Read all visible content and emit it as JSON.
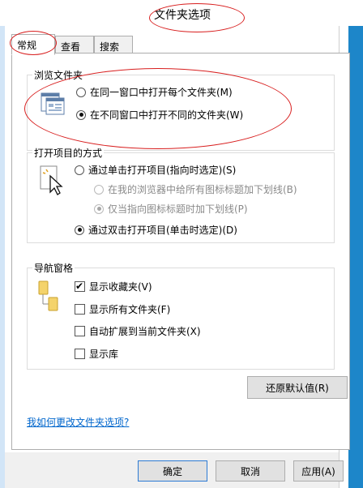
{
  "window": {
    "title": "文件夹选项"
  },
  "tabs": [
    {
      "label": "常规",
      "active": true
    },
    {
      "label": "查看",
      "active": false
    },
    {
      "label": "搜索",
      "active": false
    }
  ],
  "browse": {
    "title": "浏览文件夹",
    "options": [
      {
        "label": "在同一窗口中打开每个文件夹(M)",
        "checked": false
      },
      {
        "label": "在不同窗口中打开不同的文件夹(W)",
        "checked": true
      }
    ]
  },
  "click": {
    "title": "打开项目的方式",
    "single": {
      "label": "通过单击打开项目(指向时选定)(S)",
      "checked": false
    },
    "sub_options": [
      {
        "label": "在我的浏览器中给所有图标标题加下划线(B)",
        "checked": false,
        "enabled": false
      },
      {
        "label": "仅当指向图标标题时加下划线(P)",
        "checked": true,
        "enabled": false
      }
    ],
    "double": {
      "label": "通过双击打开项目(单击时选定)(D)",
      "checked": true
    }
  },
  "nav": {
    "title": "导航窗格",
    "options": [
      {
        "label": "显示收藏夹(V)",
        "checked": true
      },
      {
        "label": "显示所有文件夹(F)",
        "checked": false
      },
      {
        "label": "自动扩展到当前文件夹(X)",
        "checked": false
      },
      {
        "label": "显示库",
        "checked": false
      }
    ]
  },
  "restore_label": "还原默认值(R)",
  "help_link": "我如何更改文件夹选项?",
  "footer": {
    "ok": "确定",
    "cancel": "取消",
    "apply": "应用(A)"
  },
  "colors": {
    "annotation": "#d81e1e",
    "link": "#0066cc",
    "accent": "#1d86c9"
  }
}
